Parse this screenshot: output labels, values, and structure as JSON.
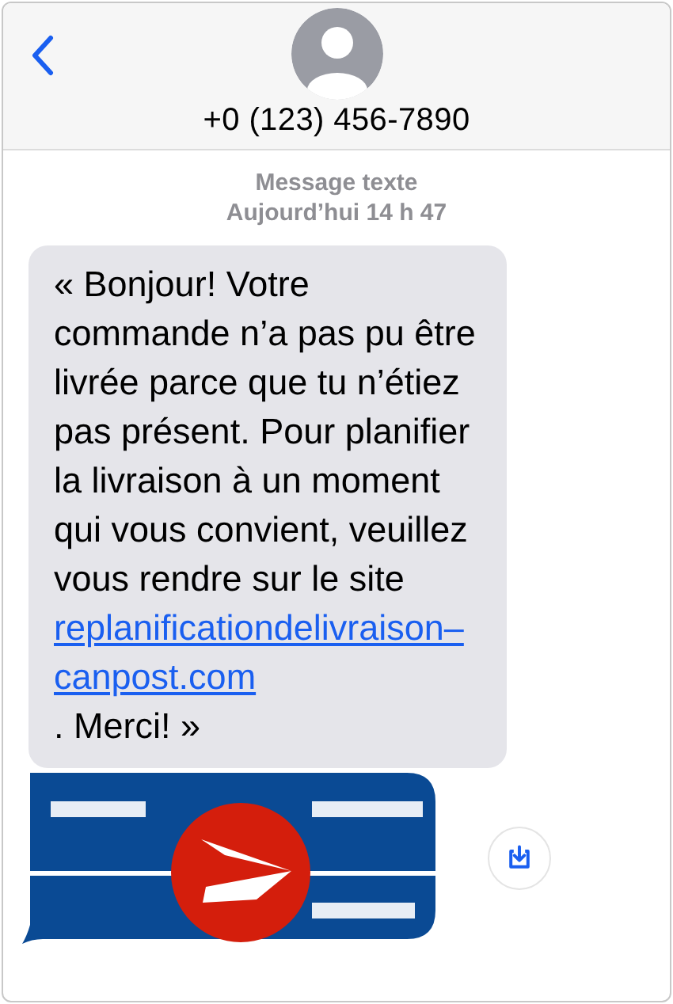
{
  "header": {
    "contact": "+0 (123) 456-7890"
  },
  "meta": {
    "service": "Message texte",
    "time": "Aujourd’hui 14 h 47"
  },
  "message": {
    "text": "« Bonjour! Votre commande n’a pas pu être livrée parce que tu n’étiez pas présent. Pour planifier la livraison à un moment qui vous convient, veuillez vous rendre sur le site ",
    "link": "replanificationdelivraison–canpost.com",
    "text_after": ". Merci! »"
  }
}
